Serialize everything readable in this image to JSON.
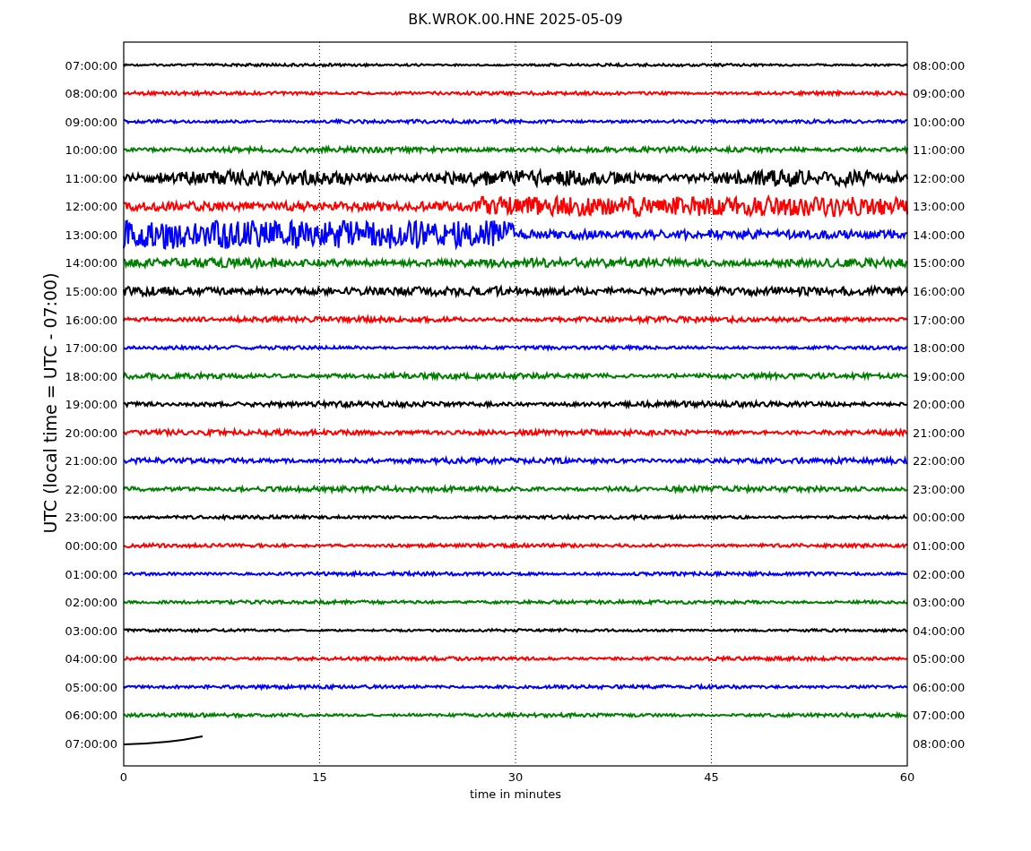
{
  "title": "BK.WROK.00.HNE 2025-05-09",
  "ylabel": "UTC (local time = UTC - 07:00)",
  "xlabel": "time in minutes",
  "xticks": [
    "0",
    "15",
    "30",
    "45",
    "60"
  ],
  "rows": [
    {
      "left": "07:00:00",
      "right": "08:00:00",
      "color": "#000000",
      "kind": "full"
    },
    {
      "left": "08:00:00",
      "right": "09:00:00",
      "color": "#ff0000",
      "kind": "full"
    },
    {
      "left": "09:00:00",
      "right": "10:00:00",
      "color": "#0000ff",
      "kind": "full"
    },
    {
      "left": "10:00:00",
      "right": "11:00:00",
      "color": "#008000",
      "kind": "full"
    },
    {
      "left": "11:00:00",
      "right": "12:00:00",
      "color": "#000000",
      "kind": "full"
    },
    {
      "left": "12:00:00",
      "right": "13:00:00",
      "color": "#ff0000",
      "kind": "full"
    },
    {
      "left": "13:00:00",
      "right": "14:00:00",
      "color": "#0000ff",
      "kind": "full"
    },
    {
      "left": "14:00:00",
      "right": "15:00:00",
      "color": "#008000",
      "kind": "full"
    },
    {
      "left": "15:00:00",
      "right": "16:00:00",
      "color": "#000000",
      "kind": "full"
    },
    {
      "left": "16:00:00",
      "right": "17:00:00",
      "color": "#ff0000",
      "kind": "full"
    },
    {
      "left": "17:00:00",
      "right": "18:00:00",
      "color": "#0000ff",
      "kind": "full"
    },
    {
      "left": "18:00:00",
      "right": "19:00:00",
      "color": "#008000",
      "kind": "full"
    },
    {
      "left": "19:00:00",
      "right": "20:00:00",
      "color": "#000000",
      "kind": "full"
    },
    {
      "left": "20:00:00",
      "right": "21:00:00",
      "color": "#ff0000",
      "kind": "full"
    },
    {
      "left": "21:00:00",
      "right": "22:00:00",
      "color": "#0000ff",
      "kind": "full"
    },
    {
      "left": "22:00:00",
      "right": "23:00:00",
      "color": "#008000",
      "kind": "full"
    },
    {
      "left": "23:00:00",
      "right": "00:00:00",
      "color": "#000000",
      "kind": "full"
    },
    {
      "left": "00:00:00",
      "right": "01:00:00",
      "color": "#ff0000",
      "kind": "full"
    },
    {
      "left": "01:00:00",
      "right": "02:00:00",
      "color": "#0000ff",
      "kind": "full"
    },
    {
      "left": "02:00:00",
      "right": "03:00:00",
      "color": "#008000",
      "kind": "full"
    },
    {
      "left": "03:00:00",
      "right": "04:00:00",
      "color": "#000000",
      "kind": "full"
    },
    {
      "left": "04:00:00",
      "right": "05:00:00",
      "color": "#ff0000",
      "kind": "full"
    },
    {
      "left": "05:00:00",
      "right": "06:00:00",
      "color": "#0000ff",
      "kind": "full"
    },
    {
      "left": "06:00:00",
      "right": "07:00:00",
      "color": "#008000",
      "kind": "full"
    },
    {
      "left": "07:00:00",
      "right": "08:00:00",
      "color": "#000000",
      "kind": "partial"
    }
  ]
}
